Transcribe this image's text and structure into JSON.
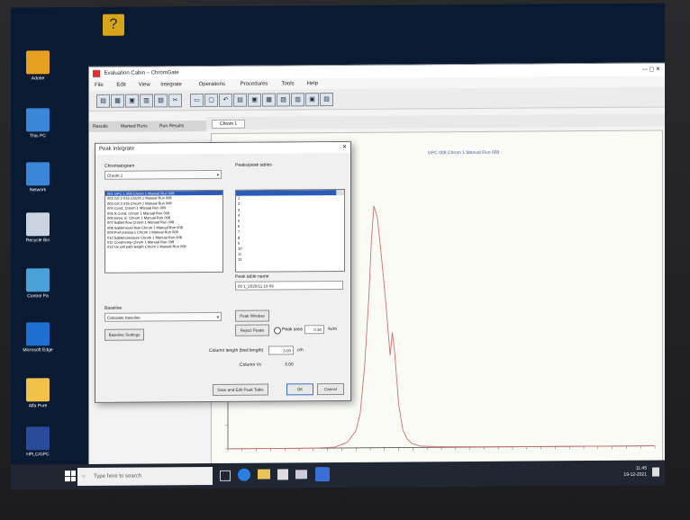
{
  "desktop": {
    "icons": [
      {
        "label": "Adobe",
        "icon": "adobe-icon",
        "color": "#e8a020"
      },
      {
        "label": "This PC",
        "icon": "computer-icon",
        "color": "#3a86d8"
      },
      {
        "label": "Network",
        "icon": "network-icon",
        "color": "#3a86d8"
      },
      {
        "label": "Recycle Bin",
        "icon": "recycle-bin-icon",
        "color": "#c9d4e0"
      },
      {
        "label": "Control Pa",
        "icon": "control-panel-icon",
        "color": "#4aa0d8"
      },
      {
        "label": "Microsoft Edge",
        "icon": "edge-icon",
        "color": "#1d6fd1"
      },
      {
        "label": "Alfa Pure",
        "icon": "folder-icon",
        "color": "#f0c24a"
      },
      {
        "label": "HPLC/GPC",
        "icon": "app-icon",
        "color": "#2a4a9a"
      }
    ]
  },
  "app": {
    "title": "Evaluation Cabin – ChromGate",
    "menus": [
      "File",
      "Edit",
      "View",
      "Integrate",
      "Operations",
      "Procedures",
      "Tools",
      "Help"
    ],
    "left_tabs": [
      "Results",
      "Marked Runs",
      "Run Results"
    ],
    "document_tab": "Chrom 1",
    "legend_text": "GPC 008 Chrom 1 Manual Run 008",
    "accent": "#2b5bb8"
  },
  "chart_data": {
    "type": "line",
    "title": "",
    "xlabel": "",
    "ylabel": "",
    "series": [
      {
        "name": "GPC 008 Chrom 1 Manual Run 008",
        "color": "#d07070",
        "x": [
          0,
          10,
          20,
          25,
          28,
          30,
          31,
          32,
          33,
          33.6,
          34.2,
          35,
          36,
          37,
          38,
          38.5,
          39,
          40,
          41,
          42,
          43,
          45,
          50,
          60,
          80,
          100
        ],
        "y": [
          0,
          0,
          0,
          0.3,
          2,
          6,
          12,
          28,
          52,
          72,
          84,
          80,
          66,
          50,
          32,
          40,
          34,
          15,
          6,
          3,
          1.5,
          0.5,
          0.2,
          0.1,
          0,
          0
        ]
      }
    ],
    "xlim": [
      0,
      100
    ],
    "ylim": [
      0,
      100
    ],
    "grid": false
  },
  "dialog": {
    "title": "Peak Integrate",
    "chromatogram_label": "Chromatogram",
    "chromatogram_select": "Chrom 1",
    "chromatograms": [
      "001 GPC 1 008 Chrom 1 Manual Run 008",
      "002 GX 2 016 Chrom 1 Manual Run 008",
      "003 GX 3 016 Chrom 1 Manual Run 008",
      "004 Cond. Chrom 1 Manual Run 009",
      "005 S Cond. Chrom 1 Manual Run 009",
      "006 Dens. E. Chrom 1 Manual Run 008",
      "007 Sablet flow Chrom 1 Manual Run 008",
      "008 Sablet-level flow Chrom 1 Manual Run 008",
      "009 Pref pressure Chrom 1 Manual Run 008",
      "010 Sablet-pressure Chrom 1 Manual Run 008",
      "011 Cond-temp Chrom 1 Manual Run 008",
      "012 Uv cell path length Chrom 1 Manual Run 008"
    ],
    "peak_list_label": "Peaks/peak tables",
    "peak_rows": [
      "",
      "1",
      "2",
      "3",
      "4",
      "5",
      "6",
      "7",
      "8",
      "9",
      "10",
      "11",
      "12"
    ],
    "peak_table_name_label": "Peak table name",
    "peak_table_name": "00 1_2020/11 19 09",
    "baseline_label": "Baseline",
    "baseline_value": "Calculate baseline",
    "baseline_settings_button": "Baseline Settings",
    "peak_window_button": "Peak Window",
    "reject_peaks_button": "Reject Peaks",
    "peak_area_label": "Peak area",
    "peak_area_value": "0.30",
    "peak_area_unit": "%/m",
    "column_length_label": "Column length (bed length)",
    "column_length_value": "3.00",
    "column_length_unit": "cm",
    "column_vc_label": "Column Vc",
    "column_vc_value": "3.00",
    "save_button": "Save and Edit Peak Table",
    "ok_button": "OK",
    "cancel_button": "Cancel"
  },
  "taskbar": {
    "search_placeholder": "Type here to search",
    "time": "11:45",
    "date": "19-12-2021"
  }
}
